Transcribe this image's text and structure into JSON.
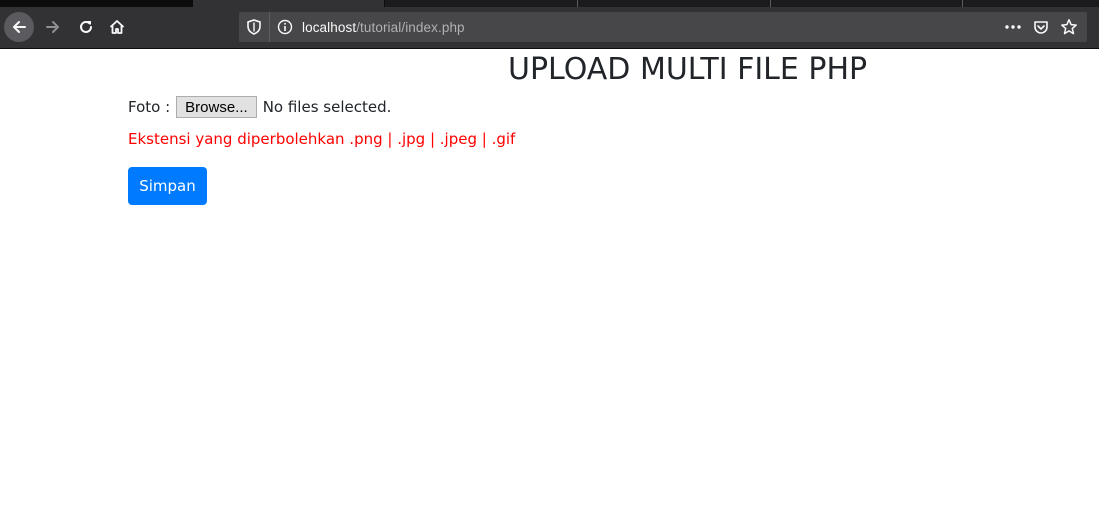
{
  "browser": {
    "url_host": "localhost",
    "url_path": "/tutorial/index.php",
    "icons": {
      "back": "arrow-left-icon",
      "forward": "arrow-right-icon",
      "reload": "reload-icon",
      "home": "home-icon",
      "tracking": "shield-icon",
      "site_info": "info-icon",
      "page_actions": "more-dots-icon",
      "pocket": "pocket-icon",
      "bookmark": "star-icon"
    },
    "colors": {
      "chrome": "#323234",
      "urlbar": "#474749"
    }
  },
  "page": {
    "title": "UPLOAD MULTI FILE PHP",
    "foto_label": "Foto :",
    "browse_label": "Browse...",
    "file_status": "No files selected.",
    "hint": "Ekstensi yang diperbolehkan .png | .jpg | .jpeg | .gif",
    "save_label": "Simpan",
    "colors": {
      "hint": "#ff0000",
      "primary_button": "#007bff"
    }
  }
}
